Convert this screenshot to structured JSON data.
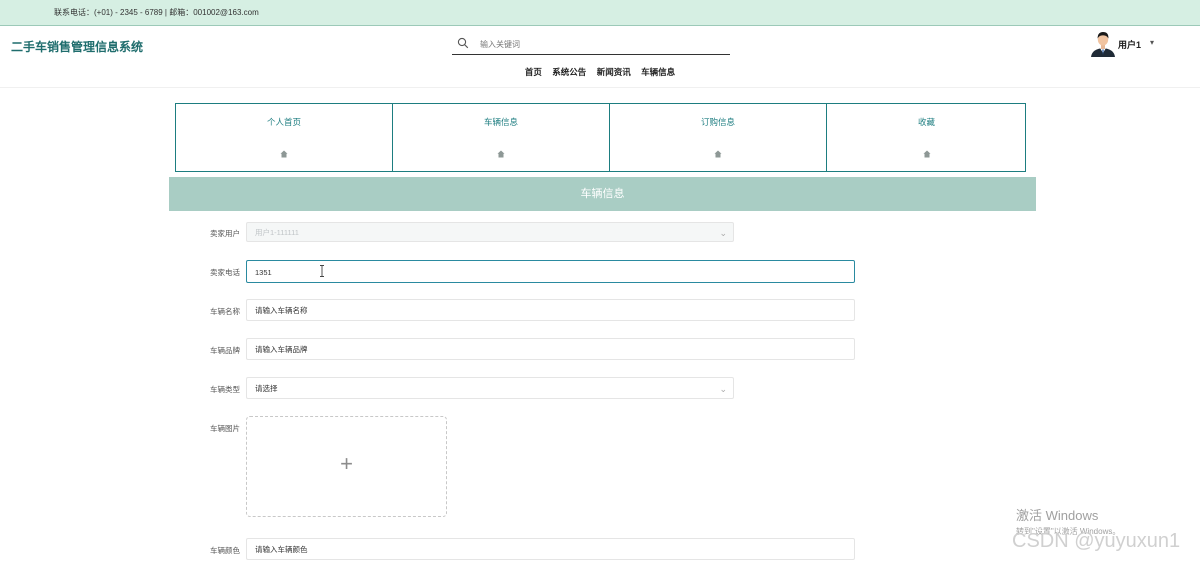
{
  "topbar": {
    "contact": "联系电话：(+01) - 2345 - 6789 | 邮箱：001002@163.com"
  },
  "header": {
    "brand": "二手车销售管理信息系统",
    "search_placeholder": "输入关键词",
    "user_name": "用户1",
    "user_caret": "▾"
  },
  "nav": {
    "items": [
      "首页",
      "系统公告",
      "新闻资讯",
      "车辆信息"
    ]
  },
  "tabs": [
    "个人首页",
    "车辆信息",
    "订购信息",
    "收藏"
  ],
  "banner": "车辆信息",
  "form": {
    "buyer_user": {
      "label": "卖家用户",
      "value": "用户1-111111"
    },
    "buyer_phone": {
      "label": "卖家电话",
      "value": "1351"
    },
    "car_name": {
      "label": "车辆名称",
      "placeholder": "请输入车辆名称"
    },
    "car_brand": {
      "label": "车辆品牌",
      "placeholder": "请输入车辆品牌"
    },
    "car_type": {
      "label": "车辆类型",
      "placeholder": "请选择"
    },
    "car_image": {
      "label": "车辆图片",
      "plus": "+"
    },
    "car_color": {
      "label": "车辆颜色",
      "placeholder": "请输入车辆颜色"
    }
  },
  "watermark": {
    "line1": "激活 Windows",
    "line2": "转到\"设置\"以激活 Windows。"
  },
  "csdn": "CSDN @yuyuxun1",
  "colors": {
    "topbar_bg": "#d6efe3",
    "accent": "#1d7d80",
    "banner_bg": "#a9cdc4"
  }
}
